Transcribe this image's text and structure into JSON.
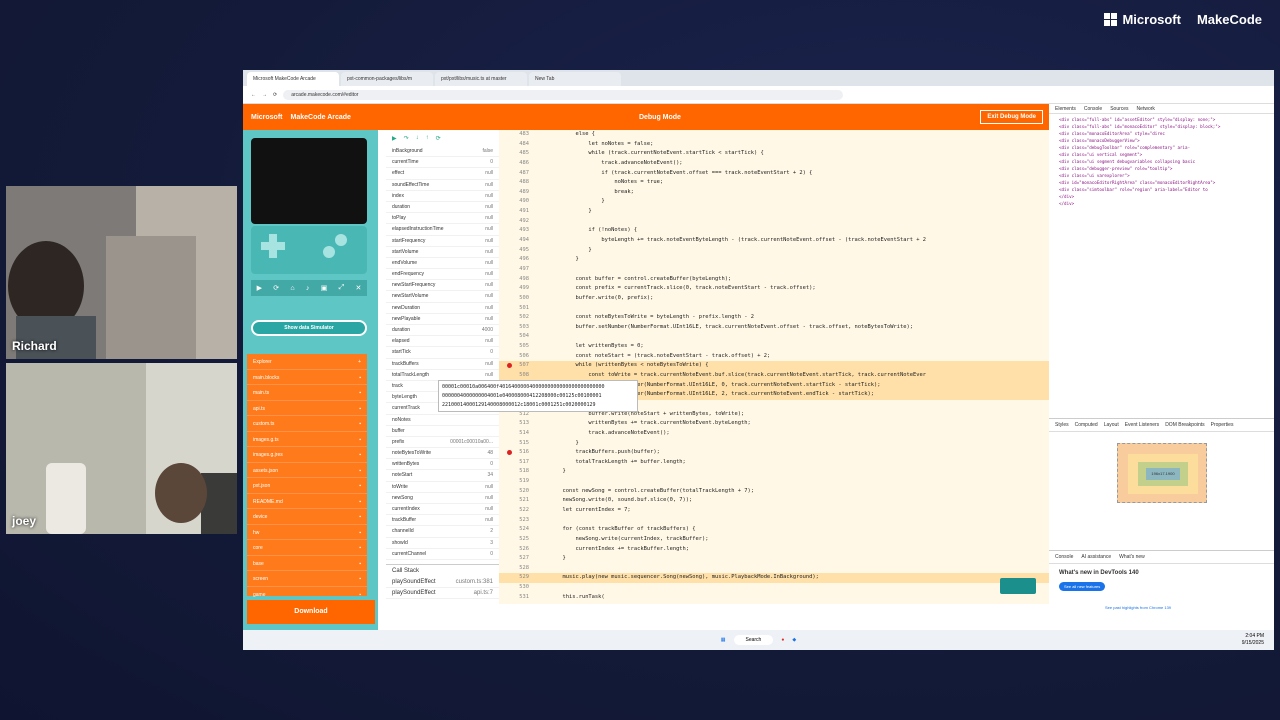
{
  "stage": {
    "brand_company": "Microsoft",
    "brand_product": "MakeCode"
  },
  "participants": [
    {
      "name": "Richard"
    },
    {
      "name": "joey"
    }
  ],
  "browser": {
    "tabs": [
      "Microsoft MakeCode Arcade",
      "pxt-common-packages/libs/m",
      "pxt/pxt/libs/music.ts at master",
      "New Tab"
    ],
    "url": "arcade.makecode.com/#editor"
  },
  "makecode": {
    "ms_label": "Microsoft",
    "app_title": "MakeCode Arcade",
    "mode": "Debug Mode",
    "exit_button": "Exit Debug Mode",
    "show_data": "Show data Simulator",
    "download": "Download",
    "explorer_label": "Explorer",
    "call_stack_label": "Call Stack",
    "files": [
      [
        "main.blocks",
        ""
      ],
      [
        "main.ts",
        ""
      ],
      [
        "api.ts",
        ""
      ],
      [
        "custom.ts",
        ""
      ],
      [
        "images.g.ts",
        ""
      ],
      [
        "images.g.jres",
        ""
      ],
      [
        "assets.json",
        ""
      ],
      [
        "pxt.json",
        ""
      ],
      [
        "README.md",
        ""
      ],
      [
        "device",
        ""
      ],
      [
        "hw",
        ""
      ],
      [
        "core",
        ""
      ],
      [
        "base",
        ""
      ],
      [
        "screen",
        ""
      ],
      [
        "game",
        ""
      ]
    ],
    "vars": [
      [
        "inBackground",
        "false"
      ],
      [
        "currentTime",
        "0"
      ],
      [
        "effect",
        "null"
      ],
      [
        "soundEffectTime",
        "null"
      ],
      [
        "index",
        "null"
      ],
      [
        "duration",
        "null"
      ],
      [
        "toPlay",
        "null"
      ],
      [
        "elapsedInstructionTime",
        "null"
      ],
      [
        "startFrequency",
        "null"
      ],
      [
        "startVolume",
        "null"
      ],
      [
        "endVolume",
        "null"
      ],
      [
        "endFrequency",
        "null"
      ],
      [
        "newStartFrequency",
        "null"
      ],
      [
        "newStartVolume",
        "null"
      ],
      [
        "newDuration",
        "null"
      ],
      [
        "newPlayable",
        "null"
      ],
      [
        "duration",
        "4000"
      ],
      [
        "elapsed",
        "null"
      ],
      [
        "startTick",
        "0"
      ],
      [
        "trackBuffers",
        "null"
      ],
      [
        "totalTrackLength",
        "null"
      ],
      [
        "track",
        "MelodicTrack"
      ],
      [
        "byteLength",
        "82"
      ],
      [
        "currentTrack",
        ""
      ],
      [
        "noNotes",
        ""
      ],
      [
        "buffer",
        ""
      ],
      [
        "prefix",
        "00001c00010a00..."
      ],
      [
        "noteBytesToWrite",
        "48"
      ],
      [
        "writtenBytes",
        "0"
      ],
      [
        "noteStart",
        "34"
      ],
      [
        "toWrite",
        "null"
      ],
      [
        "newSong",
        "null"
      ],
      [
        "currentIndex",
        "null"
      ],
      [
        "trackBuffer",
        "null"
      ],
      [
        "channelId",
        "2"
      ],
      [
        "showId",
        "3"
      ],
      [
        "currentChannel",
        "0"
      ]
    ],
    "callstack": [
      [
        "playSoundEffect",
        "custom.ts:381"
      ],
      [
        "playSoundEffect",
        "api.ts:7"
      ]
    ],
    "code": [
      [
        "483",
        "          else {",
        false,
        false
      ],
      [
        "484",
        "              let noNotes = false;",
        false,
        false
      ],
      [
        "485",
        "              while (track.currentNoteEvent.startTick < startTick) {",
        false,
        false
      ],
      [
        "486",
        "                  track.advanceNoteEvent();",
        false,
        false
      ],
      [
        "487",
        "                  if (track.currentNoteEvent.offset === track.noteEventStart + 2) {",
        false,
        false
      ],
      [
        "488",
        "                      noNotes = true;",
        false,
        false
      ],
      [
        "489",
        "                      break;",
        false,
        false
      ],
      [
        "490",
        "                  }",
        false,
        false
      ],
      [
        "491",
        "              }",
        false,
        false
      ],
      [
        "492",
        "",
        false,
        false
      ],
      [
        "493",
        "              if (!noNotes) {",
        false,
        false
      ],
      [
        "494",
        "                  byteLength += track.noteEventByteLength - (track.currentNoteEvent.offset - (track.noteEventStart + 2",
        false,
        false
      ],
      [
        "495",
        "              }",
        false,
        false
      ],
      [
        "496",
        "          }",
        false,
        false
      ],
      [
        "497",
        "",
        false,
        false
      ],
      [
        "498",
        "          const buffer = control.createBuffer(byteLength);",
        false,
        false
      ],
      [
        "499",
        "          const prefix = currentTrack.slice(0, track.noteEventStart - track.offset);",
        false,
        false
      ],
      [
        "500",
        "          buffer.write(0, prefix);",
        false,
        false
      ],
      [
        "501",
        "",
        false,
        false
      ],
      [
        "502",
        "          const noteBytesToWrite = byteLength - prefix.length - 2",
        false,
        false
      ],
      [
        "503",
        "          buffer.setNumber(NumberFormat.UInt16LE, track.currentNoteEvent.offset - track.offset, noteBytesToWrite);",
        false,
        false
      ],
      [
        "504",
        "",
        false,
        false
      ],
      [
        "505",
        "          let writtenBytes = 0;",
        false,
        false
      ],
      [
        "506",
        "          const noteStart = (track.noteEventStart - track.offset) + 2;",
        false,
        false
      ],
      [
        "507",
        "          while (writtenBytes < noteBytesToWrite) {",
        true,
        true
      ],
      [
        "508",
        "              const toWrite = track.currentNoteEvent.buf.slice(track.currentNoteEvent.startTick, track.currentNoteEver",
        true,
        false
      ],
      [
        "509",
        "              toWrite.setNumber(NumberFormat.UInt16LE, 0, track.currentNoteEvent.startTick - startTick);",
        true,
        false
      ],
      [
        "510",
        "              toWrite.setNumber(NumberFormat.UInt16LE, 2, track.currentNoteEvent.endTick - startTick);",
        true,
        false
      ],
      [
        "511",
        "",
        false,
        false
      ],
      [
        "512",
        "              buffer.write(noteStart + writtenBytes, toWrite);",
        false,
        false
      ],
      [
        "513",
        "              writtenBytes += track.currentNoteEvent.byteLength;",
        false,
        false
      ],
      [
        "514",
        "              track.advanceNoteEvent();",
        false,
        false
      ],
      [
        "515",
        "          }",
        false,
        false
      ],
      [
        "516",
        "          trackBuffers.push(buffer);",
        false,
        true
      ],
      [
        "517",
        "          totalTrackLength += buffer.length;",
        false,
        false
      ],
      [
        "518",
        "      }",
        false,
        false
      ],
      [
        "519",
        "",
        false,
        false
      ],
      [
        "520",
        "      const newSong = control.createBuffer(totalTrackLength + 7);",
        false,
        false
      ],
      [
        "521",
        "      newSong.write(0, sound.buf.slice(0, 7));",
        false,
        false
      ],
      [
        "522",
        "      let currentIndex = 7;",
        false,
        false
      ],
      [
        "523",
        "",
        false,
        false
      ],
      [
        "524",
        "      for (const trackBuffer of trackBuffers) {",
        false,
        false
      ],
      [
        "525",
        "          newSong.write(currentIndex, trackBuffer);",
        false,
        false
      ],
      [
        "526",
        "          currentIndex += trackBuffer.length;",
        false,
        false
      ],
      [
        "527",
        "      }",
        false,
        false
      ],
      [
        "528",
        "",
        false,
        false
      ],
      [
        "529",
        "      music.play(new music.sequencer.Song(newSong), music.PlaybackMode.InBackground);",
        true,
        false
      ],
      [
        "530",
        "",
        false,
        false
      ],
      [
        "531",
        "      this.runTask(",
        false,
        false
      ]
    ],
    "tooltip": [
      "00001c00010a006400f40164000004000000000000000000000000",
      "0000004000000004001e040008000412208000c00125c00100001",
      "22100014000129140008000012c18001c0001251c0020000129"
    ]
  },
  "devtools": {
    "tabs": [
      "Elements",
      "Console",
      "Sources",
      "Network"
    ],
    "style_tabs": [
      "Styles",
      "Computed",
      "Layout",
      "Event Listeners",
      "DOM Breakpoints",
      "Properties"
    ],
    "whatsnew_tabs": [
      "Console",
      "AI assistance",
      "What's new"
    ],
    "whatsnew_title": "What's new in DevTools 140",
    "see_all": "See all new features",
    "highlight": "See past highlights from Chrome 139",
    "tree": [
      "<div class=\"full-abs\" id=\"assetEditor\" style=\"display: none;\">",
      "<div class=\"full-abs\" id=\"monacoEditor\" style=\"display: block;\">",
      "<div class=\"monacoEditorArea\" style=\"direc",
      "<div class=\"monacoDebuggerView\">",
      "<div class=\"debugToolbar\" role=\"complementary\" aria-",
      "<div class=\"ui vertical segment\">",
      "<div class=\"ui segment debugvariables collapsing basic",
      "<div class=\"debugger-preview\" role=\"tooltip\">",
      "<div class=\"ui varexplorer\">",
      "<div id=\"monacoEditorRightArea\" class=\"monacoEditorRightArea\">",
      "<div class=\"simtoolbar\" role=\"region\" aria-label=\"Editor to",
      "</div>",
      "</div>"
    ],
    "box_size": "196x17.1900"
  },
  "taskbar": {
    "search": "Search",
    "time": "2:04 PM",
    "date": "9/15/2025"
  }
}
